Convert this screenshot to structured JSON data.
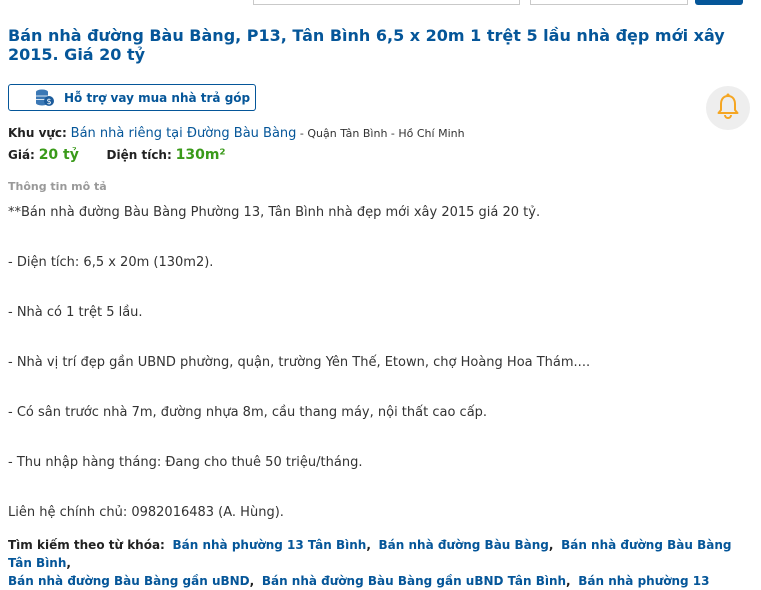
{
  "listing": {
    "title": "Bán nhà đường Bàu Bàng, P13, Tân Bình 6,5 x 20m 1 trệt 5 lầu nhà đẹp mới xây 2015. Giá 20 tỷ",
    "loan_button": "Hỗ trợ vay mua nhà trả góp",
    "area_label": "Khu vực:",
    "area_link": "Bán nhà riêng tại Đường Bàu Bàng",
    "area_rest": " - Quận Tân Bình - Hồ Chí Minh",
    "price_label": "Giá:",
    "price_value": "20 tỷ",
    "size_label": "Diện tích:",
    "size_value": "130m²"
  },
  "description": {
    "heading": "Thông tin mô tả",
    "lines": [
      "**Bán nhà đường Bàu Bàng Phường 13, Tân Bình nhà đẹp mới xây 2015 giá 20 tỷ.",
      "- Diện tích: 6,5 x 20m (130m2).",
      "- Nhà có 1 trệt 5 lầu.",
      "- Nhà vị trí đẹp gần UBND phường, quận, trường Yên Thế, Etown, chợ Hoàng Hoa Thám....",
      "- Có sân trước nhà 7m, đường nhựa 8m, cầu thang máy, nội thất cao cấp.",
      "- Thu nhập hàng tháng: Đang cho thuê 50 triệu/tháng.",
      "Liên hệ chính chủ: 0982016483 (A. Hùng)."
    ]
  },
  "keywords": {
    "label": "Tìm kiếm theo từ khóa:",
    "items": [
      "Bán nhà phường 13 Tân Bình",
      "Bán nhà đường Bàu Bàng",
      "Bán nhà đường Bàu Bàng Tân Bình",
      "Bán nhà đường Bàu Bàng gần uBND",
      "Bán nhà đường Bàu Bàng gần uBND Tân Bình",
      "Bán nhà phường 13"
    ],
    "separator": ","
  },
  "colors": {
    "link": "#055699",
    "price": "#3a9a1a",
    "bell": "#f5a623",
    "heading_muted": "#999999"
  },
  "icons": {
    "loan": "coins-icon",
    "notify": "bell-icon"
  }
}
